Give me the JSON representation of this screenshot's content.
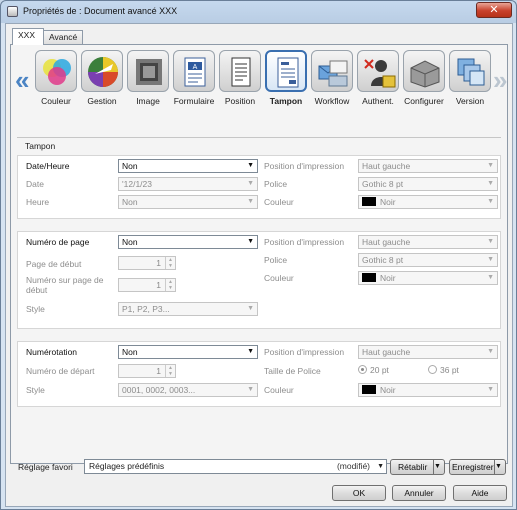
{
  "window": {
    "title": "Propriétés de : Document avancé XXX",
    "close_glyph": "✕"
  },
  "tabs": [
    {
      "label": "XXX",
      "active": true
    },
    {
      "label": "Avancé",
      "active": false
    }
  ],
  "toolbar": {
    "prev_glyph": "«",
    "next_glyph": "»",
    "items": [
      {
        "label": "Couleur",
        "icon": "color-circles-icon"
      },
      {
        "label": "Gestion",
        "icon": "color-wheel-icon"
      },
      {
        "label": "Image",
        "icon": "image-frame-icon"
      },
      {
        "label": "Formulaire",
        "icon": "form-icon"
      },
      {
        "label": "Position",
        "icon": "page-position-icon"
      },
      {
        "label": "Tampon",
        "icon": "stamp-page-icon",
        "selected": true
      },
      {
        "label": "Workflow",
        "icon": "workflow-icon"
      },
      {
        "label": "Authent.",
        "icon": "authentication-icon"
      },
      {
        "label": "Configurer",
        "icon": "printer-configure-icon"
      },
      {
        "label": "Version",
        "icon": "version-icon"
      }
    ]
  },
  "group_title": "Tampon",
  "date_section": {
    "label": "Date/Heure",
    "value": "Non",
    "date_label": "Date",
    "date_value": "'12/1/23",
    "heure_label": "Heure",
    "heure_value": "Non",
    "pos_label": "Position d'impression",
    "pos_value": "Haut gauche",
    "police_label": "Police",
    "police_value": "Gothic 8 pt",
    "couleur_label": "Couleur",
    "couleur_value": "Noir"
  },
  "page_section": {
    "label": "Numéro de page",
    "value": "Non",
    "debut_label": "Page de début",
    "debut_value": "1",
    "num_label": "Numéro sur page de début",
    "num_value": "1",
    "style_label": "Style",
    "style_value": "P1, P2, P3...",
    "pos_label": "Position d'impression",
    "pos_value": "Haut gauche",
    "police_label": "Police",
    "police_value": "Gothic 8 pt",
    "couleur_label": "Couleur",
    "couleur_value": "Noir"
  },
  "num_section": {
    "label": "Numérotation",
    "value": "Non",
    "depart_label": "Numéro de départ",
    "depart_value": "1",
    "style_label": "Style",
    "style_value": "0001, 0002, 0003...",
    "pos_label": "Position d'impression",
    "pos_value": "Haut gauche",
    "taille_label": "Taille de Police",
    "taille_opt1": "20 pt",
    "taille_opt2": "36 pt",
    "couleur_label": "Couleur",
    "couleur_value": "Noir"
  },
  "favorites": {
    "label": "Réglage favori",
    "value": "Réglages prédéfinis",
    "modified": "(modifié)",
    "restore_label": "Rétablir",
    "save_label": "Enregistrer"
  },
  "buttons": {
    "ok": "OK",
    "cancel": "Annuler",
    "help": "Aide"
  },
  "glyphs": {
    "dropdown": "▼",
    "spin_up": "▲",
    "spin_down": "▼"
  }
}
